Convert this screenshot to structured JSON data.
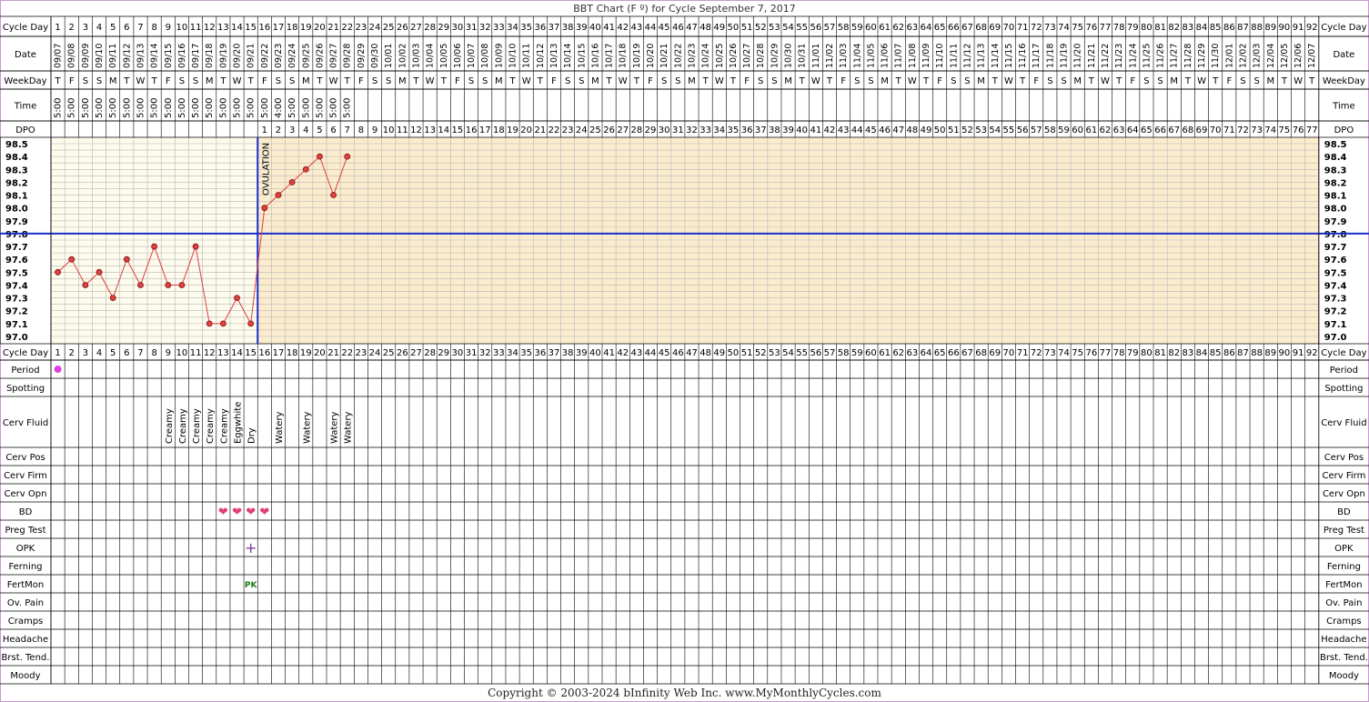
{
  "title": "BBT Chart (F º) for Cycle September 7, 2017",
  "copyright": "Copyright © 2003-2024 bInfinity Web Inc.     www.MyMonthlyCycles.com",
  "colors": {
    "pre_ovulation_bg": "#fdfbec",
    "post_ovulation_bg": "#fbeccd",
    "grid": "#b8b8b8",
    "temp_line": "#e04040",
    "coverline": "#1a2ec9",
    "ovulation_line": "#1a2ec9",
    "heart": "#e0407a",
    "period_dot": "#e040e0",
    "opk": "#7a3a9a",
    "fertmon": "#1a7a1a",
    "frame": "#c79ad0"
  },
  "labels": {
    "cycle_day": "Cycle Day",
    "date": "Date",
    "weekday": "WeekDay",
    "time": "Time",
    "dpo": "DPO",
    "ovulation": "OVULATION",
    "rows": [
      "Period",
      "Spotting",
      "Cerv Fluid",
      "Cerv Pos",
      "Cerv Firm",
      "Cerv Opn",
      "BD",
      "Preg Test",
      "OPK",
      "Ferning",
      "FertMon",
      "Ov. Pain",
      "Cramps",
      "Headache",
      "Brst. Tend.",
      "Moody"
    ]
  },
  "columns": {
    "count": 92,
    "start_date": "09/07",
    "dates": [
      "09/07",
      "09/08",
      "09/09",
      "09/10",
      "09/11",
      "09/12",
      "09/13",
      "09/14",
      "09/15",
      "09/16",
      "09/17",
      "09/18",
      "09/19",
      "09/20",
      "09/21",
      "09/22",
      "09/23",
      "09/24",
      "09/25",
      "09/26",
      "09/27",
      "09/28",
      "09/29",
      "09/30",
      "10/01",
      "10/02",
      "10/03",
      "10/04",
      "10/05",
      "10/06",
      "10/07",
      "10/08",
      "10/09",
      "10/10",
      "10/11",
      "10/12",
      "10/13",
      "10/14",
      "10/15",
      "10/16",
      "10/17",
      "10/18",
      "10/19",
      "10/20",
      "10/21",
      "10/22",
      "10/23",
      "10/24",
      "10/25",
      "10/26",
      "10/27",
      "10/28",
      "10/29",
      "10/30",
      "10/31",
      "11/01",
      "11/02",
      "11/03",
      "11/04",
      "11/05",
      "11/06",
      "11/07",
      "11/08",
      "11/09",
      "11/10",
      "11/11",
      "11/12",
      "11/13",
      "11/14",
      "11/15",
      "11/16",
      "11/17",
      "11/18",
      "11/19",
      "11/20",
      "11/21",
      "11/22",
      "11/23",
      "11/24",
      "11/25",
      "11/26",
      "11/27",
      "11/28",
      "11/29",
      "11/30",
      "12/01",
      "12/02",
      "12/03",
      "12/04",
      "12/05",
      "12/06",
      "12/07"
    ],
    "weekdays_cycle": [
      "T",
      "F",
      "S",
      "S",
      "M",
      "T",
      "W"
    ],
    "times": [
      "5:00",
      "5:00",
      "5:00",
      "5:00",
      "5:00",
      "5:00",
      "5:00",
      "5:00",
      "5:00",
      "5:00",
      "5:00",
      "5:00",
      "5:00",
      "5:00",
      "5:00",
      "5:00",
      "4:00",
      "5:00",
      "5:00",
      "5:00",
      "5:00",
      "5:00"
    ],
    "dpo_start_day": 16,
    "dpo_max": 77
  },
  "chart_data": {
    "type": "line",
    "title": "BBT Chart (F º) for Cycle September 7, 2017",
    "xlabel": "Cycle Day",
    "ylabel": "",
    "ylim": [
      97.0,
      98.5
    ],
    "yticks": [
      "98.5",
      "98.4",
      "98.3",
      "98.2",
      "98.1",
      "98.0",
      "97.9",
      "97.8",
      "97.7",
      "97.6",
      "97.5",
      "97.4",
      "97.3",
      "97.2",
      "97.1",
      "97.0"
    ],
    "x": [
      1,
      2,
      3,
      4,
      5,
      6,
      7,
      8,
      9,
      10,
      11,
      12,
      13,
      14,
      15,
      16,
      17,
      18,
      19,
      20,
      21,
      22
    ],
    "series": [
      {
        "values": [
          97.5,
          97.6,
          97.4,
          97.5,
          97.3,
          97.6,
          97.4,
          97.7,
          97.4,
          97.4,
          97.7,
          97.1,
          97.1,
          97.3,
          97.1,
          98.0,
          98.1,
          98.2,
          98.3,
          98.4,
          98.1,
          98.4
        ]
      }
    ],
    "coverline": 97.8,
    "ovulation_day": 15,
    "grid": true
  },
  "observations": {
    "period": [
      1
    ],
    "cerv_fluid": [
      {
        "day": 9,
        "text": "Creamy"
      },
      {
        "day": 10,
        "text": "Creamy"
      },
      {
        "day": 11,
        "text": "Creamy"
      },
      {
        "day": 12,
        "text": "Creamy"
      },
      {
        "day": 13,
        "text": "Creamy"
      },
      {
        "day": 14,
        "text": "Eggwhite"
      },
      {
        "day": 15,
        "text": "Dry"
      },
      {
        "day": 17,
        "text": "Watery"
      },
      {
        "day": 19,
        "text": "Watery"
      },
      {
        "day": 21,
        "text": "Watery"
      },
      {
        "day": 22,
        "text": "Watery"
      }
    ],
    "bd": [
      13,
      14,
      15,
      16
    ],
    "bd_symbol": "❤",
    "opk": [
      {
        "day": 15,
        "text": "+"
      }
    ],
    "fertmon": [
      {
        "day": 15,
        "text": "PK"
      }
    ]
  }
}
